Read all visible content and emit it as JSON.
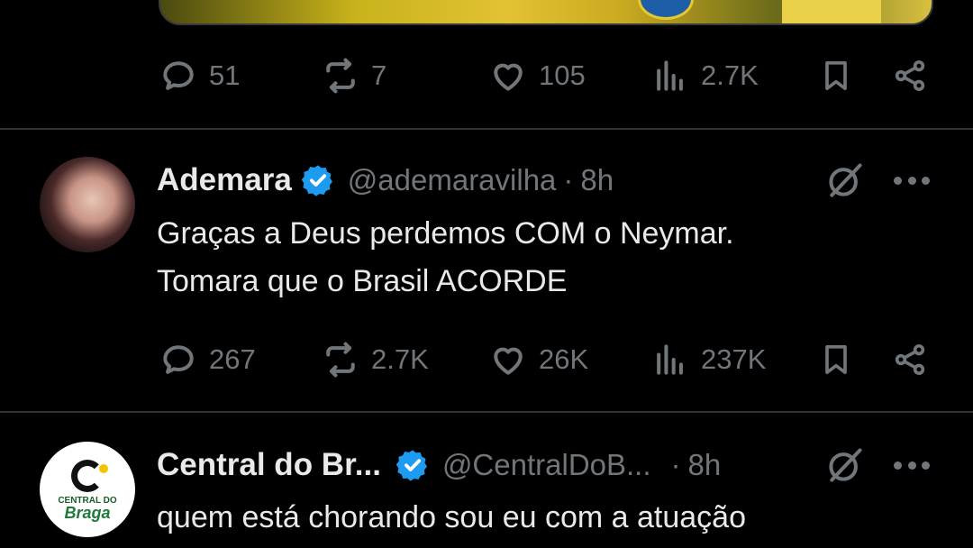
{
  "tweets": [
    {
      "actions": {
        "replies": "51",
        "reposts": "7",
        "likes": "105",
        "views": "2.7K"
      }
    },
    {
      "name": "Ademara",
      "handle": "@ademaravilha",
      "separator": "·",
      "time": "8h",
      "text_lines": [
        "Graças a Deus perdemos COM o Neymar.",
        "Tomara que o Brasil ACORDE"
      ],
      "actions": {
        "replies": "267",
        "reposts": "2.7K",
        "likes": "26K",
        "views": "237K"
      }
    },
    {
      "name": "Central do Br...",
      "handle": "@CentralDoB...",
      "separator": "·",
      "time": "8h",
      "avatar_text": [
        "CENTRAL DO",
        "Braga"
      ],
      "text_lines": [
        "quem está chorando sou eu com a atuação"
      ]
    }
  ],
  "icons": {
    "reply": "reply-icon",
    "repost": "repost-icon",
    "like": "like-icon",
    "views": "views-icon",
    "bookmark": "bookmark-icon",
    "share": "share-icon",
    "verified": "verified-badge-icon",
    "grok": "grok-icon",
    "more": "more-icon"
  },
  "colors": {
    "background": "#000000",
    "text": "#e7e9ea",
    "muted": "#71767b",
    "verified": "#1d9bf0",
    "divider": "#2f3336"
  }
}
